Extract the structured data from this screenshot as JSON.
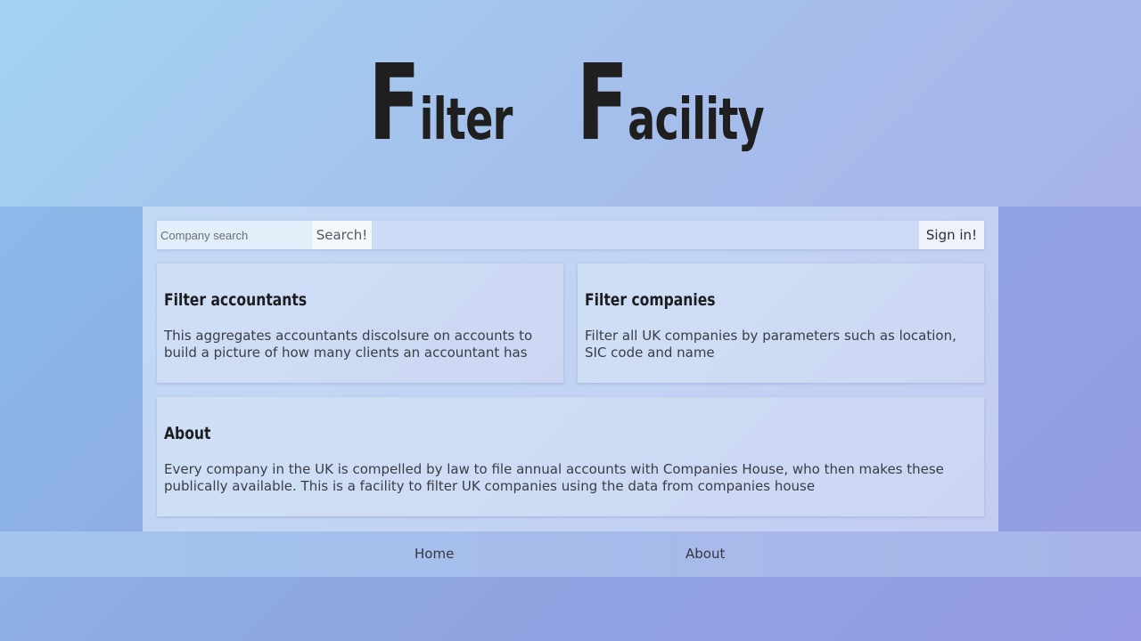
{
  "header": {
    "title_word1_cap": "F",
    "title_word1_rest": "ilter",
    "title_word2_cap": "F",
    "title_word2_rest": "acility"
  },
  "toolbar": {
    "search_placeholder": "Company search",
    "search_value": "",
    "search_button_label": "Search!",
    "signin_label": "Sign in!"
  },
  "cards": [
    {
      "title": "Filter accountants",
      "body": "This aggregates accountants discolsure on accounts to build a picture of how many clients an accountant has"
    },
    {
      "title": "Filter companies",
      "body": "Filter all UK companies by parameters such as location, SIC code and name"
    },
    {
      "title": "About",
      "body": "Every company in the UK is compelled by law to file annual accounts with Companies House, who then makes these publically available. This is a facility to filter UK companies using the data from companies house"
    }
  ],
  "footer": {
    "nav": [
      {
        "label": "Home"
      },
      {
        "label": "About"
      }
    ]
  },
  "colors": {
    "title_text": "#1f1f1f",
    "body_text": "#3a3d45",
    "header_bg": "#a5c0ec",
    "main_bg": "#c3d3f3",
    "card_bg": "#cedbf5"
  }
}
